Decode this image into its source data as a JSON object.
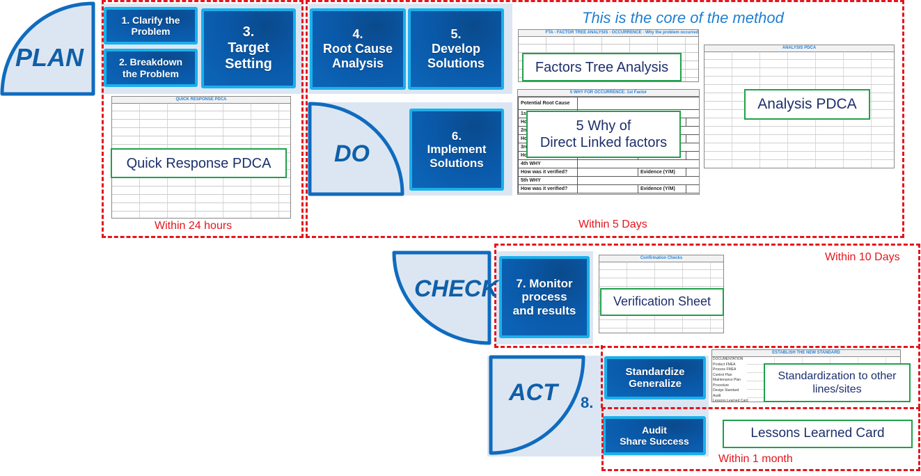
{
  "phases": {
    "plan": {
      "label": "PLAN"
    },
    "do": {
      "label": "DO"
    },
    "check": {
      "label": "CHECK"
    },
    "act": {
      "label": "ACT",
      "step_number": "8."
    }
  },
  "steps": [
    {
      "id": "step-1",
      "label": "1. Clarify the\nProblem"
    },
    {
      "id": "step-2",
      "label": "2. Breakdown\nthe Problem"
    },
    {
      "id": "step-3",
      "label": "3.\nTarget\nSetting"
    },
    {
      "id": "step-4",
      "label": "4.\nRoot Cause\nAnalysis"
    },
    {
      "id": "step-5",
      "label": "5.\nDevelop\nSolutions"
    },
    {
      "id": "step-6",
      "label": "6.\nImplement\nSolutions"
    },
    {
      "id": "step-7",
      "label": "7. Monitor\nprocess\nand results"
    },
    {
      "id": "step-8a",
      "label": "Standardize\nGeneralize"
    },
    {
      "id": "step-8b",
      "label": "Audit\nShare Success"
    }
  ],
  "core_note": "This is the core of the method",
  "tools": {
    "quick_response": {
      "title": "Quick Response PDCA",
      "doc_header": "QUICK RESPONSE PDCA"
    },
    "factors_tree": {
      "title": "Factors Tree Analysis",
      "doc_header": "FTA - FACTOR TREE ANALYSIS - OCCURRENCE - Why the problem occurred"
    },
    "five_why": {
      "title": "5 Why of\nDirect Linked factors",
      "doc_header": "5 WHY FOR OCCURRENCE: 1st Factor",
      "rows": [
        "Potential Root Cause",
        "1st WHY",
        "How was it verified?",
        "2nd WHY",
        "How was it verified?",
        "3rd WHY",
        "How was it verified?",
        "4th WHY",
        "How was it verified?",
        "5th WHY",
        "How was it verified?"
      ],
      "evidence_label": "Evidence (Y/M)"
    },
    "analysis_pdca": {
      "title": "Analysis PDCA",
      "doc_header": "ANALYSIS PDCA"
    },
    "verification": {
      "title": "Verification Sheet",
      "doc_header": "Confirmation Checks"
    },
    "standardization": {
      "title": "Standardization to other\nlines/sites",
      "doc_header": "ESTABLISH THE NEW STANDARD",
      "doc_rows": [
        "DOCUMENTATION",
        "Product FMEA",
        "Process FMEA",
        "Control Plan",
        "Maintenance Plan",
        "Procedure",
        "Design Standard",
        "Audit",
        "Lessons Learned Card"
      ]
    },
    "lessons": {
      "title": "Lessons Learned Card"
    }
  },
  "deadlines": {
    "plan": "Within 24 hours",
    "analysis": "Within 5 Days",
    "check": "Within 10 Days",
    "act": "Within 1 month"
  },
  "colors": {
    "accent": "#0f5fa8",
    "deadline": "#e5141b",
    "callout_border": "#1fa04a",
    "panel": "#dce6f2",
    "step_border": "#1ab0ec"
  }
}
